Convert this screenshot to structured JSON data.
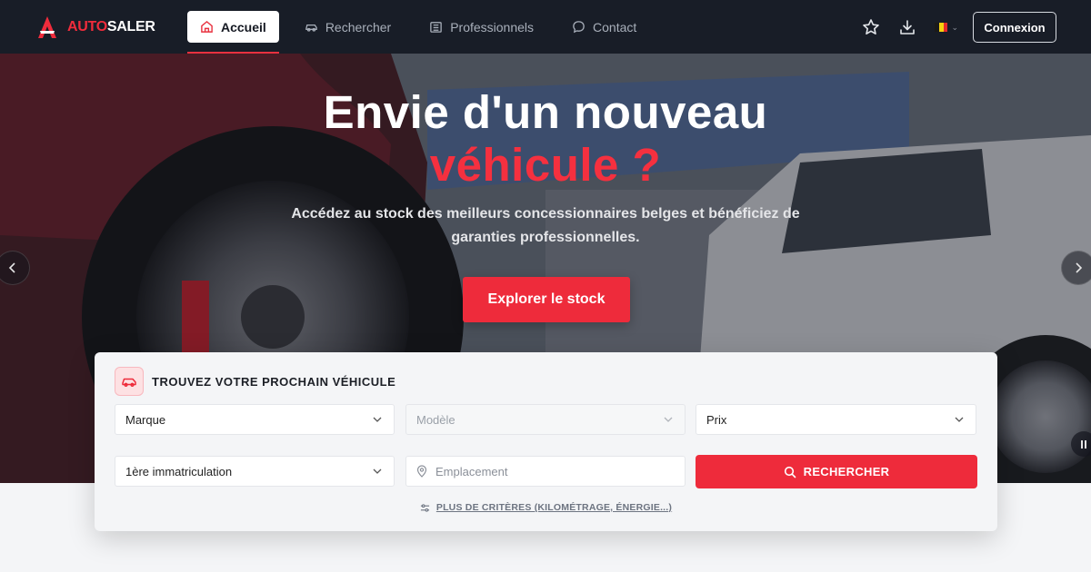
{
  "brand": {
    "part1": "AUTO",
    "part2": "SALER",
    "color": "#f02c3c"
  },
  "nav": {
    "items": [
      {
        "label": "Accueil",
        "icon": "home-icon",
        "active": true
      },
      {
        "label": "Rechercher",
        "icon": "car-icon",
        "active": false
      },
      {
        "label": "Professionnels",
        "icon": "building-icon",
        "active": false
      },
      {
        "label": "Contact",
        "icon": "chat-bubble-icon",
        "active": false
      }
    ],
    "login_label": "Connexion",
    "right_icons": [
      "star-icon",
      "download-icon",
      "belgium-flag-icon"
    ]
  },
  "hero": {
    "title_line1": "Envie d'un nouveau",
    "title_line2": "véhicule ?",
    "subtitle": "Accédez au stock des meilleurs concessionnaires belges et bénéficiez de garanties professionnelles.",
    "cta_label": "Explorer le stock"
  },
  "search": {
    "title": "TROUVEZ VOTRE PROCHAIN VÉHICULE",
    "brand_select": "Marque",
    "model_select": "Modèle",
    "price_select": "Prix",
    "registration_select": "1ère immatriculation",
    "location_placeholder": "Emplacement",
    "submit_label": "RECHERCHER",
    "more_criteria": "PLUS DE CRITÈRES (KILOMÉTRAGE, ÉNERGIE...)"
  },
  "colors": {
    "accent": "#ee2b3b",
    "navbar": "#181d27",
    "panel": "#f4f5f7"
  }
}
